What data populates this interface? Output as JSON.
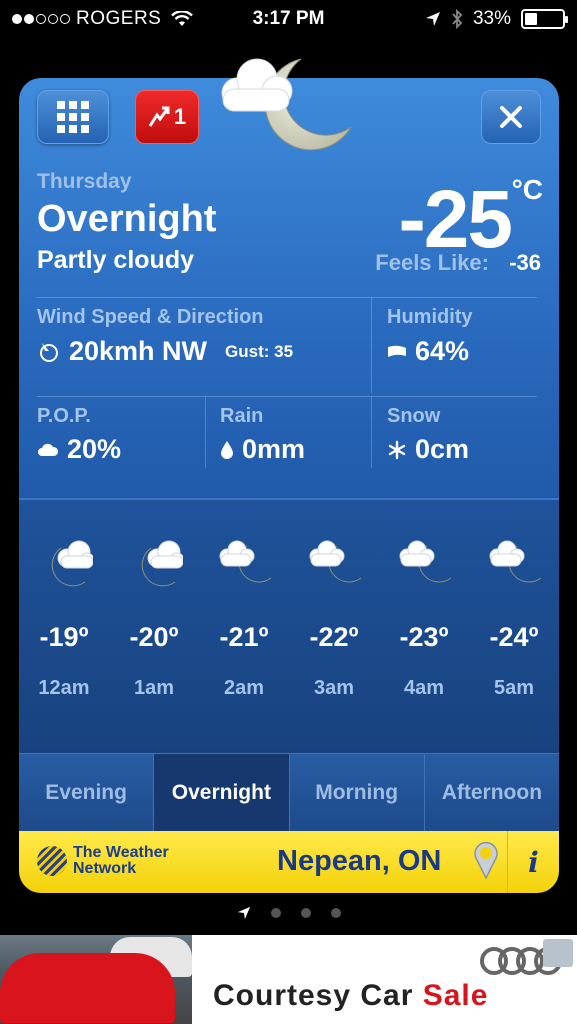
{
  "status_bar": {
    "carrier": "ROGERS",
    "time": "3:17 PM",
    "battery": "33%",
    "battery_level": 0.33
  },
  "weather": {
    "alert_count": "1",
    "day": "Thursday",
    "period": "Overnight",
    "condition": "Partly cloudy",
    "temperature": "-25",
    "unit": "°C",
    "feels_like_label": "Feels Like:",
    "feels_like_value": "-36",
    "wind_label": "Wind Speed & Direction",
    "wind_value": "20kmh NW",
    "gust_label": "Gust: 35",
    "humidity_label": "Humidity",
    "humidity_value": "64%",
    "pop_label": "P.O.P.",
    "pop_value": "20%",
    "rain_label": "Rain",
    "rain_value": "0mm",
    "snow_label": "Snow",
    "snow_value": "0cm"
  },
  "hourly": [
    {
      "temp": "-19º",
      "time": "12am",
      "icon": "partly-cloudy-night-icon"
    },
    {
      "temp": "-20º",
      "time": "1am",
      "icon": "partly-cloudy-night-icon"
    },
    {
      "temp": "-21º",
      "time": "2am",
      "icon": "cloud-moon-icon"
    },
    {
      "temp": "-22º",
      "time": "3am",
      "icon": "cloud-moon-icon"
    },
    {
      "temp": "-23º",
      "time": "4am",
      "icon": "cloud-moon-icon"
    },
    {
      "temp": "-24º",
      "time": "5am",
      "icon": "cloud-moon-icon"
    }
  ],
  "tabs": [
    {
      "label": "Evening",
      "active": false
    },
    {
      "label": "Overnight",
      "active": true
    },
    {
      "label": "Morning",
      "active": false
    },
    {
      "label": "Afternoon",
      "active": false
    }
  ],
  "footer": {
    "brand_line1": "The Weather",
    "brand_line2": "Network",
    "location": "Nepean, ON",
    "info": "i"
  },
  "ad": {
    "text_main": "Courtesy Car ",
    "text_sale": "Sale"
  },
  "colors": {
    "card_blue": "#2a6bbf",
    "footer_yellow": "#f3d20a",
    "alert_red": "#c10d0d",
    "sale_red": "#d8141c"
  }
}
